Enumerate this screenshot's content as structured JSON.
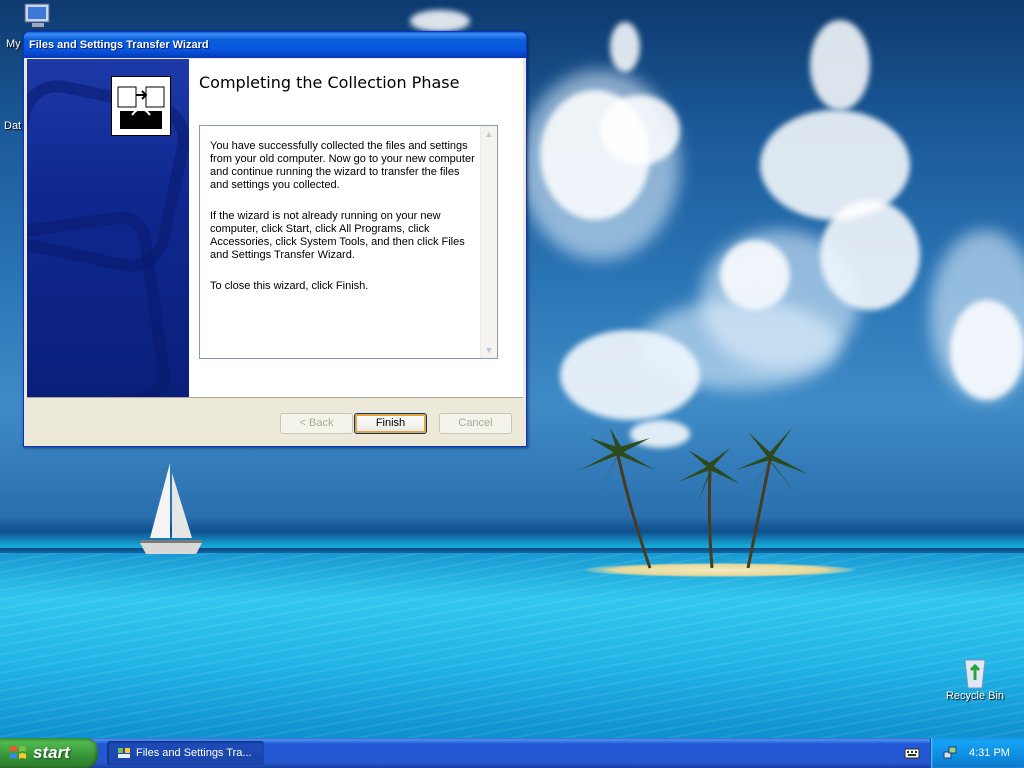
{
  "desktop": {
    "icons": [
      {
        "label": "My"
      },
      {
        "label": "Dat"
      },
      {
        "label": "Recycle Bin"
      }
    ]
  },
  "wizard": {
    "title": "Files and Settings Transfer Wizard",
    "heading": "Completing the Collection Phase",
    "paragraphs": [
      "You have successfully collected the files and settings from your old computer. Now go to your new computer and continue running the wizard to transfer the files and settings you collected.",
      "If the wizard is not already running on your new computer, click Start, click All Programs, click Accessories, click System Tools, and then click Files and Settings Transfer Wizard.",
      "To close this wizard, click Finish."
    ],
    "buttons": {
      "back": "< Back",
      "finish": "Finish",
      "cancel": "Cancel"
    }
  },
  "taskbar": {
    "start_label": "start",
    "task_label": "Files and Settings Tra...",
    "clock": "4:31 PM"
  },
  "colors": {
    "title_bar": "#0a5fd8",
    "sidebar": "#0f2890",
    "taskbar": "#2658cf",
    "start_button": "#379337",
    "default_button_ring": "#e8a23e"
  },
  "icon_names": [
    "my-computer-icon",
    "wizard-logo-icon",
    "windows-flag-icon",
    "keyboard-icon",
    "network-icon",
    "recycle-bin-icon"
  ]
}
